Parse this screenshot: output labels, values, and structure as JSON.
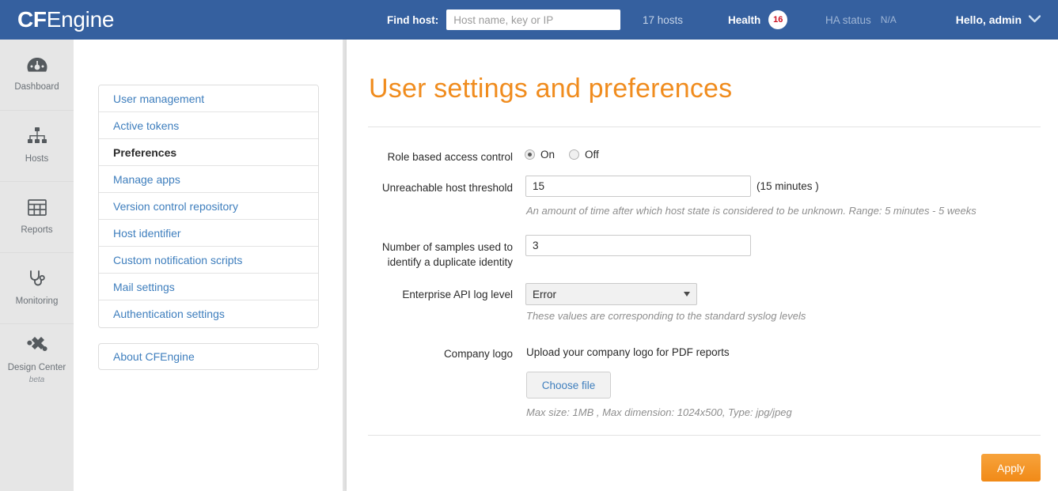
{
  "header": {
    "brand_cf": "CF",
    "brand_engine": "Engine",
    "find_host_label": "Find host:",
    "find_host_placeholder": "Host name, key or IP",
    "find_host_value": "",
    "hosts_count": "17 hosts",
    "health_label": "Health",
    "health_badge": "16",
    "ha_status_label": "HA status",
    "ha_status_value": "N/A",
    "user_greeting": "Hello, admin",
    "bar_color": "#35609f",
    "badge_text_color": "#cc1122"
  },
  "sidebar": {
    "items": [
      {
        "label": "Dashboard",
        "icon": "gauge-icon"
      },
      {
        "label": "Hosts",
        "icon": "sitemap-icon"
      },
      {
        "label": "Reports",
        "icon": "table-grid-icon"
      },
      {
        "label": "Monitoring",
        "icon": "stethoscope-icon"
      },
      {
        "label": "Design Center",
        "sublabel": "beta",
        "icon": "puzzle-icon"
      }
    ]
  },
  "nav": {
    "items": [
      {
        "label": "User management",
        "active": false
      },
      {
        "label": "Active tokens",
        "active": false
      },
      {
        "label": "Preferences",
        "active": true
      },
      {
        "label": "Manage apps",
        "active": false
      },
      {
        "label": "Version control repository",
        "active": false
      },
      {
        "label": "Host identifier",
        "active": false
      },
      {
        "label": "Custom notification scripts",
        "active": false
      },
      {
        "label": "Mail settings",
        "active": false
      },
      {
        "label": "Authentication settings",
        "active": false
      }
    ],
    "about_label": "About CFEngine",
    "link_color": "#3e7ebd"
  },
  "main": {
    "page_title": "User settings and preferences",
    "title_color": "#f08c1e",
    "fields": {
      "rbac": {
        "label": "Role based access control",
        "option_on": "On",
        "option_off": "Off",
        "selected": "On"
      },
      "unreachable": {
        "label": "Unreachable host threshold",
        "value": "15",
        "suffix": "(15 minutes )",
        "hint": "An amount of time after which host state is considered to be unknown. Range: 5 minutes - 5 weeks"
      },
      "samples": {
        "label_line1": "Number of samples used to",
        "label_line2": "identify a duplicate identity",
        "value": "3"
      },
      "log_level": {
        "label": "Enterprise API log level",
        "value": "Error",
        "options": [
          "Error"
        ],
        "hint": "These values are corresponding to the standard syslog levels"
      },
      "company_logo": {
        "label": "Company logo",
        "description": "Upload your company logo for PDF reports",
        "button_label": "Choose file",
        "hint": "Max size: 1MB , Max dimension: 1024x500, Type: jpg/jpeg"
      }
    },
    "apply_label": "Apply",
    "apply_color": "#f18a17"
  }
}
